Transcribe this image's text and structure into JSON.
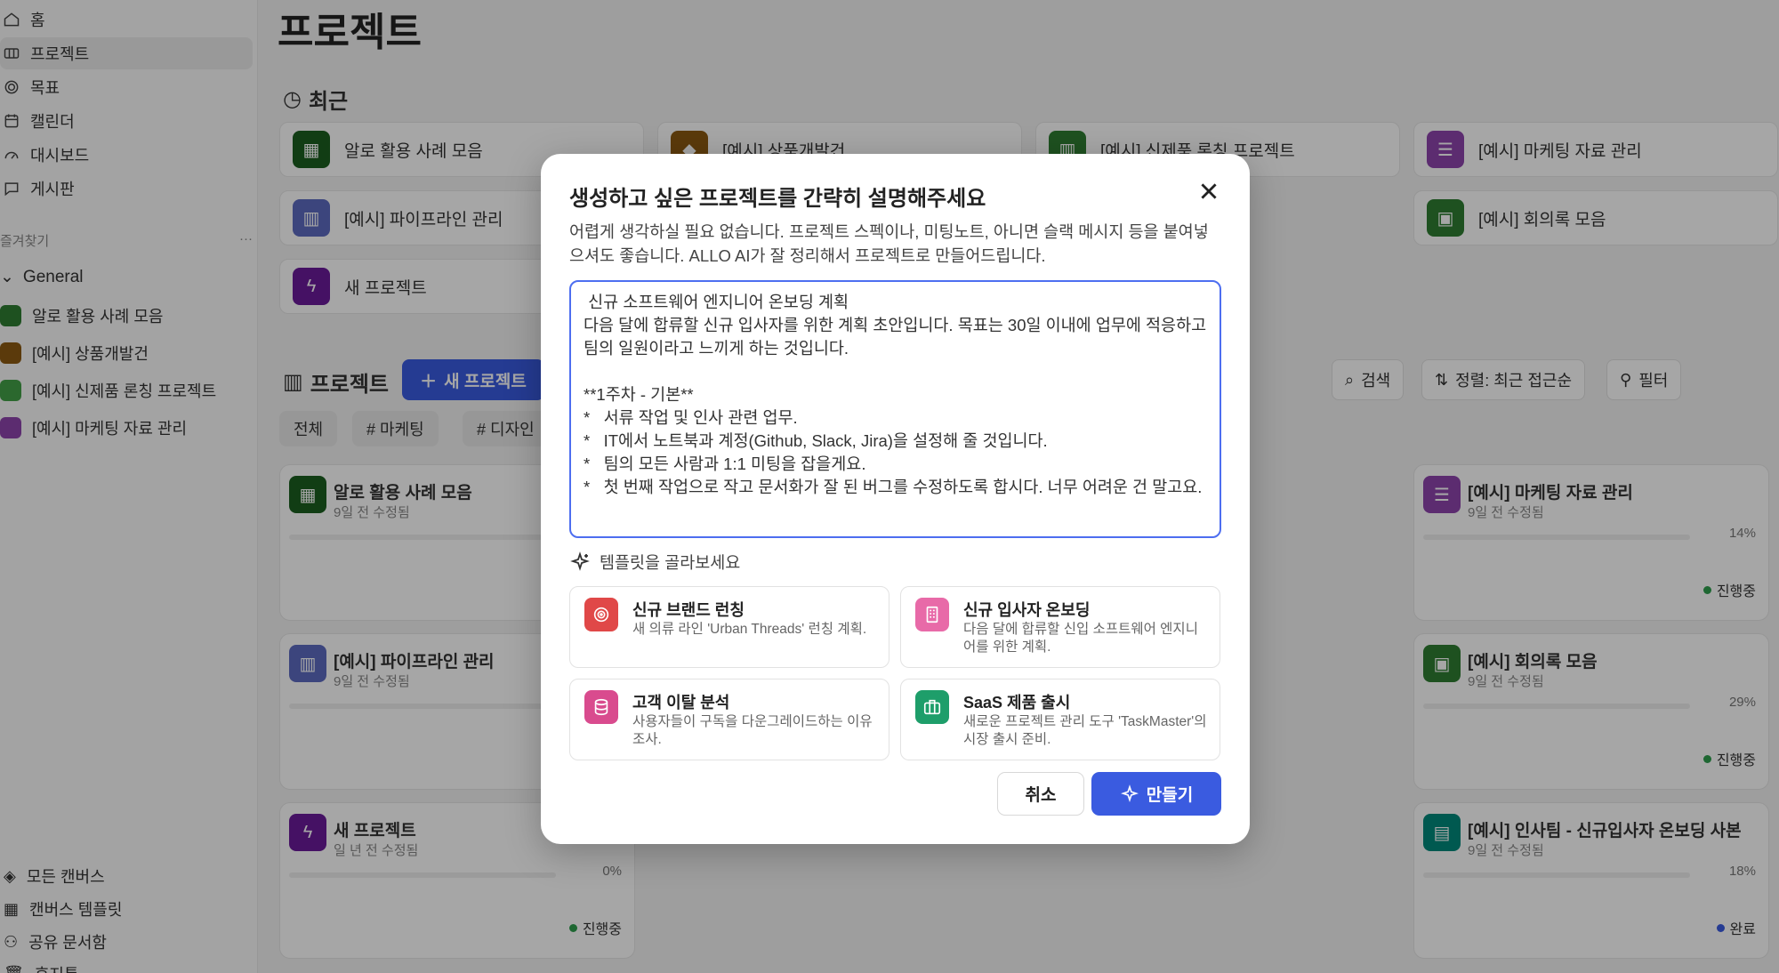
{
  "sidebar": {
    "nav": [
      {
        "label": "홈",
        "icon": "home-icon"
      },
      {
        "label": "프로젝트",
        "icon": "folder-icon"
      },
      {
        "label": "목표",
        "icon": "target-icon"
      },
      {
        "label": "캘린더",
        "icon": "calendar-icon"
      },
      {
        "label": "대시보드",
        "icon": "gauge-icon"
      },
      {
        "label": "게시판",
        "icon": "chat-icon"
      }
    ],
    "favorites_label": "즐겨찾기",
    "favorites_more": "···",
    "group_label": "General",
    "projects": [
      {
        "label": "알로 활용 사례 모음",
        "color": "#2e7d32"
      },
      {
        "label": "[예시] 상품개발건",
        "color": "#8d5a12"
      },
      {
        "label": "[예시] 신제품 론칭 프로젝트",
        "color": "#43a047"
      },
      {
        "label": "[예시] 마케팅 자료 관리",
        "color": "#8e44ad"
      }
    ],
    "bottom": [
      {
        "label": "모든 캔버스",
        "icon": "layers-icon"
      },
      {
        "label": "캔버스 템플릿",
        "icon": "template-icon"
      },
      {
        "label": "공유 문서함",
        "icon": "people-icon"
      },
      {
        "label": "휴지통",
        "icon": "trash-icon"
      }
    ]
  },
  "main": {
    "title": "프로젝트",
    "recent_label": "최근",
    "recent": [
      {
        "label": "알로 활용 사례 모음",
        "color": "#1b5e20"
      },
      {
        "label": "[예시] 상품개발건",
        "color": "#8d5a12"
      },
      {
        "label": "[예시] 신제품 론칭 프로젝트",
        "color": "#2e7d32"
      },
      {
        "label": "[예시] 마케팅 자료 관리",
        "color": "#8e44ad"
      },
      {
        "label": "[예시] 파이프라인 관리",
        "color": "#5c6bc0"
      },
      {
        "label": "[예시] 회의록 모음",
        "color": "#2e7d32"
      },
      {
        "label": "새 프로젝트",
        "color": "#6a1b9a"
      }
    ],
    "projects_label": "프로젝트",
    "new_project_label": "새 프로젝트",
    "filters": [
      "전체",
      "# 마케팅",
      "# 디자인"
    ],
    "toolbar": {
      "search": "검색",
      "sort": "정렬: 최근 접근순",
      "filter": "필터"
    },
    "cards": [
      {
        "title": "알로 활용 사례 모음",
        "sub": "9일 전 수정됨",
        "pct": "",
        "status": ""
      },
      {
        "title": "[예시] 마케팅 자료 관리",
        "sub": "9일 전 수정됨",
        "pct": "14%",
        "status": "진행중"
      },
      {
        "title": "[예시] 파이프라인 관리",
        "sub": "9일 전 수정됨",
        "pct": "",
        "status": ""
      },
      {
        "title": "[예시] 회의록 모음",
        "sub": "9일 전 수정됨",
        "pct": "29%",
        "status": "진행중"
      },
      {
        "title": "새 프로젝트",
        "sub": "일 년 전 수정됨",
        "pct": "0%",
        "status": "진행중"
      },
      {
        "title": "[예시] 인사팀 - 신규입사자 온보딩 사본",
        "sub": "9일 전 수정됨",
        "pct": "18%",
        "status": "완료"
      }
    ]
  },
  "modal": {
    "title": "생성하고 싶은 프로젝트를 간략히 설명해주세요",
    "description": "어렵게 생각하실 필요 없습니다. 프로젝트 스펙이나, 미팅노트, 아니면 슬랙 메시지 등을 붙여넣으셔도 좋습니다. ALLO AI가 잘 정리해서 프로젝트로 만들어드립니다.",
    "prompt_value": " 신규 소프트웨어 엔지니어 온보딩 계획\n다음 달에 합류할 신규 입사자를 위한 계획 초안입니다. 목표는 30일 이내에 업무에 적응하고 팀의 일원이라고 느끼게 하는 것입니다.\n\n**1주차 - 기본**\n*   서류 작업 및 인사 관련 업무.\n*   IT에서 노트북과 계정(Github, Slack, Jira)을 설정해 줄 것입니다.\n*   팀의 모든 사람과 1:1 미팅을 잡을게요.\n*   첫 번째 작업으로 작고 문서화가 잘 된 버그를 수정하도록 합시다. 너무 어려운 건 말고요.",
    "template_heading": "템플릿을 골라보세요",
    "templates": [
      {
        "title": "신규 브랜드 런칭",
        "desc": "새 의류 라인 'Urban Threads' 런칭 계획.",
        "icon": "target-icon",
        "color": "#e04848"
      },
      {
        "title": "신규 입사자 온보딩",
        "desc": "다음 달에 합류할 신입 소프트웨어 엔지니어를 위한 계획.",
        "icon": "building-icon",
        "color": "#e86aa8"
      },
      {
        "title": "고객 이탈 분석",
        "desc": "사용자들이 구독을 다운그레이드하는 이유 조사.",
        "icon": "database-icon",
        "color": "#d94b8e"
      },
      {
        "title": "SaaS 제품 출시",
        "desc": "새로운 프로젝트 관리 도구 'TaskMaster'의 시장 출시 준비.",
        "icon": "briefcase-icon",
        "color": "#1e9e6a"
      }
    ],
    "cancel_label": "취소",
    "create_label": "만들기",
    "accent": "#3a5be0"
  }
}
